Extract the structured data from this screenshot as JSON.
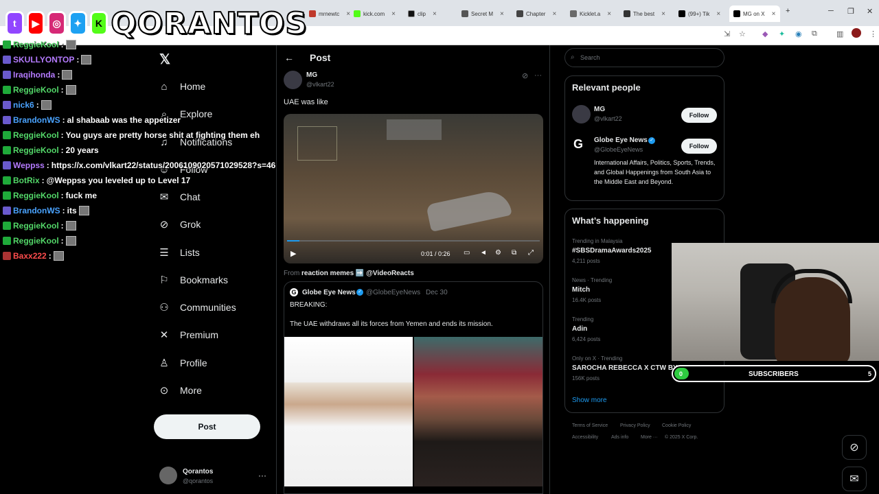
{
  "browser": {
    "tabs": [
      {
        "label": "mrnewtc",
        "color": "#c0392b"
      },
      {
        "label": "kick.com",
        "color": "#53fc18"
      },
      {
        "label": "clip",
        "color": "#000000"
      },
      {
        "label": "Secret M",
        "color": "#555555"
      },
      {
        "label": "Chapter",
        "color": "#444444"
      },
      {
        "label": "Kicklet.a",
        "color": "#6a6a6a"
      },
      {
        "label": "The best",
        "color": "#333333"
      },
      {
        "label": "(99+) Tik",
        "color": "#000000"
      },
      {
        "label": "MG on X",
        "color": "#000000"
      }
    ]
  },
  "overlay": {
    "banner_text": "QORANTOS",
    "social_icons": [
      "twitch-icon",
      "youtube-icon",
      "instagram-icon",
      "twitter-icon",
      "kick-icon"
    ]
  },
  "chat": {
    "messages": [
      {
        "user": "ReggieKool",
        "color": "#53d769",
        "text": ""
      },
      {
        "user": "SKULLYONTOP",
        "color": "#b57bff",
        "text": ""
      },
      {
        "user": "Iraqihonda",
        "color": "#b57bff",
        "text": ""
      },
      {
        "user": "ReggieKool",
        "color": "#53d769",
        "text": ""
      },
      {
        "user": "nick6",
        "color": "#4aa3ff",
        "text": ""
      },
      {
        "user": "BrandonWS",
        "color": "#4aa3ff",
        "text": "al shabaab was the appetizer"
      },
      {
        "user": "ReggieKool",
        "color": "#53d769",
        "text": "You guys are pretty horse shit at fighting them eh"
      },
      {
        "user": "ReggieKool",
        "color": "#53d769",
        "text": "20 years"
      },
      {
        "user": "Weppss",
        "color": "#b57bff",
        "text": "https://x.com/vlkart22/status/2006109020571029528?s=46"
      },
      {
        "user": "BotRix",
        "color": "#53d769",
        "text": "@Weppss you leveled up to Level 17"
      },
      {
        "user": "ReggieKool",
        "color": "#53d769",
        "text": "fuck me"
      },
      {
        "user": "BrandonWS",
        "color": "#4aa3ff",
        "text": "its"
      },
      {
        "user": "ReggieKool",
        "color": "#53d769",
        "text": ""
      },
      {
        "user": "ReggieKool",
        "color": "#53d769",
        "text": ""
      },
      {
        "user": "Baxx222",
        "color": "#ff4d4d",
        "text": ""
      }
    ]
  },
  "nav": {
    "items": [
      {
        "label": "Home",
        "icon": "home-icon"
      },
      {
        "label": "Explore",
        "icon": "search-icon"
      },
      {
        "label": "Notifications",
        "icon": "bell-icon"
      },
      {
        "label": "Follow",
        "icon": "follow-icon"
      },
      {
        "label": "Chat",
        "icon": "mail-icon"
      },
      {
        "label": "Grok",
        "icon": "grok-icon"
      },
      {
        "label": "Lists",
        "icon": "list-icon"
      },
      {
        "label": "Bookmarks",
        "icon": "bookmark-icon"
      },
      {
        "label": "Communities",
        "icon": "communities-icon"
      },
      {
        "label": "Premium",
        "icon": "x-icon"
      },
      {
        "label": "Profile",
        "icon": "profile-icon"
      },
      {
        "label": "More",
        "icon": "more-icon"
      }
    ],
    "post_label": "Post",
    "account_name": "Qorantos",
    "account_handle": "@qorantos"
  },
  "main": {
    "header": "Post",
    "author_name": "MG",
    "author_handle": "@vlkart22",
    "text": "UAE was like",
    "video_time": "0:01 / 0:26",
    "from_prefix": "From",
    "from_source": "reaction memes ➡️ @VideoReacts",
    "quote": {
      "name": "Globe Eye News",
      "handle": "@GlobeEyeNews",
      "date": "Dec 30",
      "line1": "BREAKING:",
      "line2": "The UAE withdraws all its forces from Yemen and ends its mission."
    }
  },
  "right": {
    "search_placeholder": "Search",
    "relevant_title": "Relevant people",
    "people": [
      {
        "name": "MG",
        "handle": "@vlkart22",
        "follow": "Follow"
      },
      {
        "name": "Globe Eye News",
        "handle": "@GlobeEyeNews",
        "follow": "Follow",
        "bio": "International Affairs, Politics, Sports, Trends, and Global Happenings from South Asia to the Middle East and Beyond."
      }
    ],
    "happening_title": "What’s happening",
    "trends": [
      {
        "category": "Trending in Malaysia",
        "name": "#SBSDramaAwards2025",
        "count": "4,211 posts"
      },
      {
        "category": "News · Trending",
        "name": "Mitch",
        "count": "16.4K posts"
      },
      {
        "category": "Trending",
        "name": "Adin",
        "count": "6,424 posts"
      },
      {
        "category": "Only on X · Trending",
        "name": "SAROCHA REBECCA X CTW BY",
        "count": "156K posts"
      }
    ],
    "show_more": "Show more",
    "footer": [
      "Terms of Service",
      "Privacy Policy",
      "Cookie Policy",
      "Accessibility",
      "Ads info",
      "More ···",
      "© 2025 X Corp."
    ]
  },
  "webcam": {
    "subscribers_label": "SUBSCRIBERS",
    "current": "0",
    "goal": "5",
    "progress": 0
  }
}
